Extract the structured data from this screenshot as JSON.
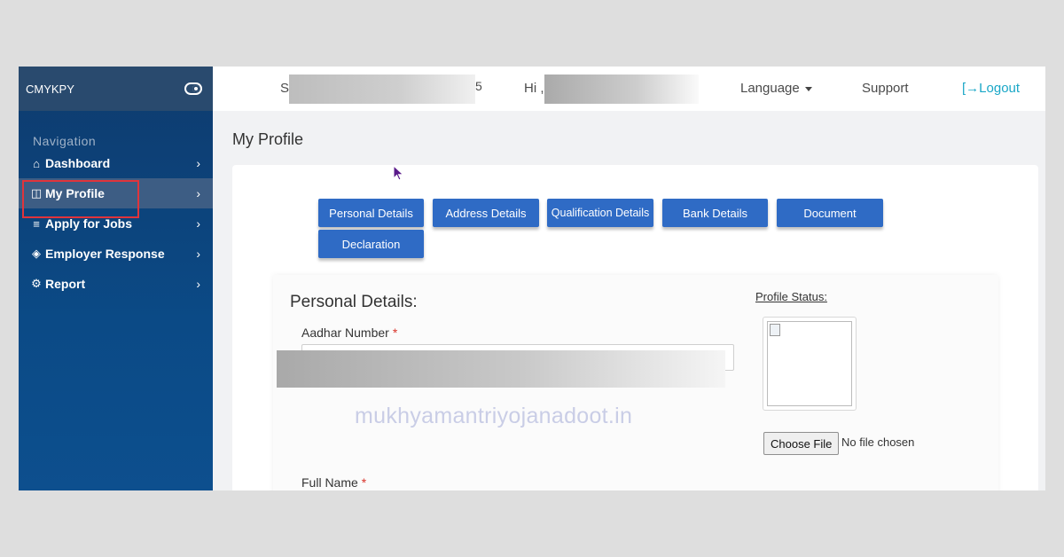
{
  "sidebar": {
    "brand": "CMYKPY",
    "nav_title": "Navigation",
    "items": [
      {
        "label": "Dashboard",
        "icon": "home-icon"
      },
      {
        "label": "My Profile",
        "icon": "profile-icon"
      },
      {
        "label": "Apply for Jobs",
        "icon": "menu-icon"
      },
      {
        "label": "Employer Response",
        "icon": "layers-icon"
      },
      {
        "label": "Report",
        "icon": "report-icon"
      }
    ]
  },
  "topbar": {
    "greeting_prefix_left": "Su",
    "greeting_suffix_left": "5",
    "hi": "Hi ,",
    "language": "Language",
    "support": "Support",
    "logout": "Logout"
  },
  "main": {
    "page_title": "My Profile",
    "tabs": [
      "Personal Details",
      "Address Details",
      "Qualification Details",
      "Bank Details",
      "Document",
      "Declaration"
    ],
    "section_title": "Personal Details:",
    "aadhar_label": "Aadhar Number",
    "full_name_label": "Full Name",
    "required_mark": "*",
    "profile_status_label": "Profile Status:",
    "choose_file": "Choose File",
    "no_file": "No file chosen"
  },
  "watermark": "mukhyamantriyojanadoot.in",
  "colors": {
    "sidebar": "#0d4a86",
    "sidebar_header": "#294a6e",
    "tab_button": "#2f6bc5",
    "logout": "#1aa7c7",
    "highlight": "#e0343b"
  }
}
